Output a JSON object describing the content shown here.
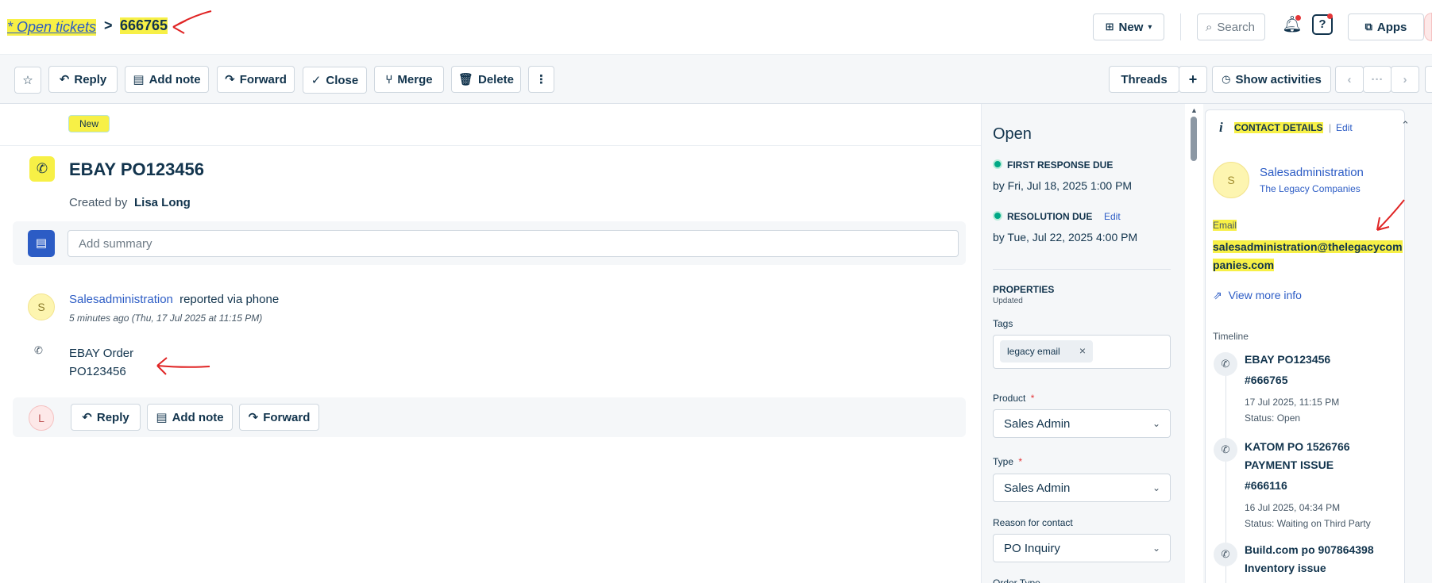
{
  "header": {
    "breadcrumb_link": "* Open tickets",
    "breadcrumb_sep": ">",
    "ticket_id": "666765",
    "new_label": "New",
    "search_placeholder": "Search",
    "apps_label": "Apps"
  },
  "toolbar": {
    "reply": "Reply",
    "add_note": "Add note",
    "forward": "Forward",
    "close": "Close",
    "merge": "Merge",
    "delete": "Delete",
    "threads": "Threads",
    "plus": "+",
    "show_activities": "Show activities"
  },
  "ticket": {
    "status_tag": "New",
    "subject": "EBAY PO123456",
    "created_by_label": "Created by",
    "created_by": "Lisa Long",
    "summary_placeholder": "Add summary",
    "reporter_initial": "S",
    "reporter": "Salesadministration",
    "reported_via": "reported via phone",
    "timestamp": "5 minutes ago (Thu, 17 Jul 2025 at 11:15 PM)",
    "body_line1": "EBAY Order",
    "body_line2": "PO123456",
    "reply_initial": "L",
    "reply": "Reply",
    "add_note": "Add note",
    "forward": "Forward"
  },
  "properties": {
    "status": "Open",
    "first_response_label": "FIRST RESPONSE DUE",
    "first_response_value": "by Fri, Jul 18, 2025 1:00 PM",
    "resolution_label": "RESOLUTION DUE",
    "resolution_edit": "Edit",
    "resolution_value": "by Tue, Jul 22, 2025 4:00 PM",
    "section_title": "PROPERTIES",
    "section_sub": "Updated",
    "tags_label": "Tags",
    "tag": "legacy email",
    "tag_remove": "×",
    "product_label": "Product",
    "product_value": "Sales Admin",
    "type_label": "Type",
    "type_value": "Sales Admin",
    "reason_label": "Reason for contact",
    "reason_value": "PO Inquiry",
    "order_type_label": "Order Type",
    "required_mark": "*"
  },
  "contact": {
    "title": "CONTACT DETAILS",
    "sep": "|",
    "edit": "Edit",
    "initial": "S",
    "name": "Salesadministration",
    "company": "The Legacy Companies",
    "email_label": "Email",
    "email_line1": "salesadministration@thelegacycom",
    "email_line2": "panies.com",
    "view_more": "View more info",
    "timeline_label": "Timeline",
    "timeline": [
      {
        "line1": "EBAY PO123456",
        "line2": "",
        "id": "#666765",
        "date": "17 Jul 2025, 11:15 PM",
        "status": "Status: Open"
      },
      {
        "line1": "KATOM PO 1526766",
        "line2": "PAYMENT ISSUE",
        "id": "#666116",
        "date": "16 Jul 2025, 04:34 PM",
        "status": "Status: Waiting on Third Party"
      },
      {
        "line1": "Build.com po 907864398",
        "line2": "Inventory issue",
        "id": "",
        "date": "",
        "status": ""
      }
    ]
  },
  "colors": {
    "highlight": "#f7f046",
    "link": "#2c5cc5",
    "annotation": "#e02424",
    "sla_green": "#00a886"
  }
}
